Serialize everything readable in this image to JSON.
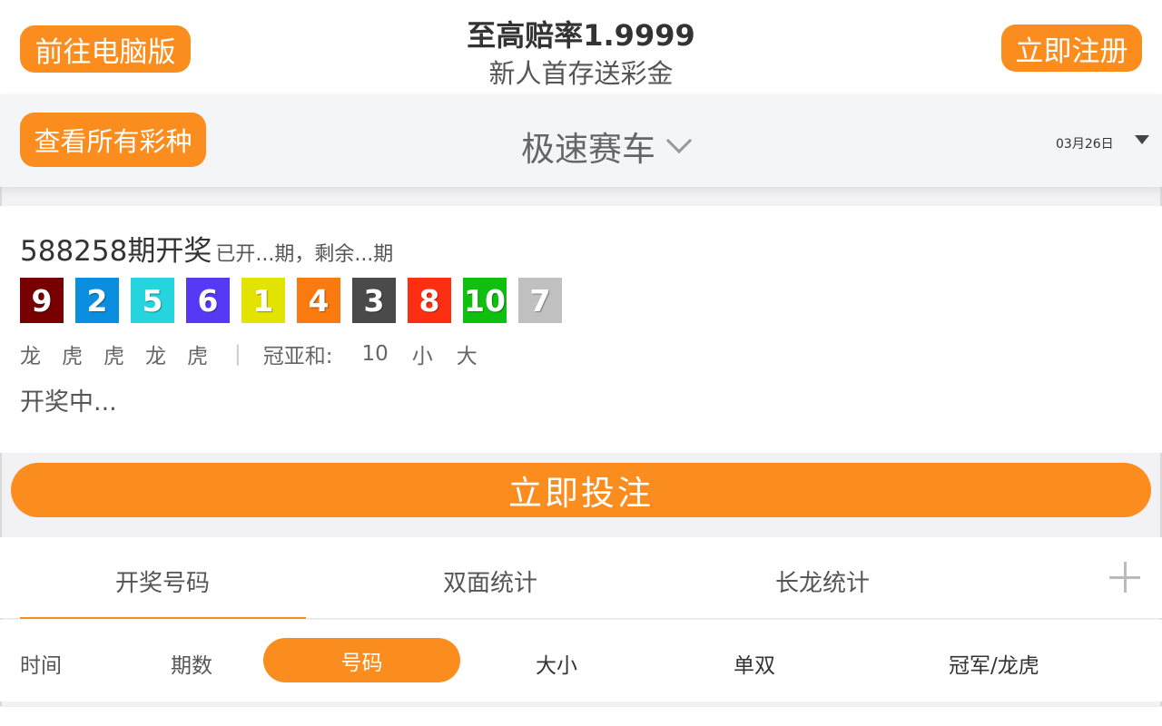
{
  "header": {
    "pc_button": "前往电脑版",
    "promo_title": "至高赔率1.9999",
    "promo_subtitle": "新人首存送彩金",
    "register_button": "立即注册"
  },
  "lottery_bar": {
    "all_lottery_button": "查看所有彩种",
    "lottery_name": "极速赛车",
    "date": "03月26日"
  },
  "result": {
    "issue": "588258期开奖",
    "progress": "已开...期，剩余...期",
    "balls": [
      {
        "number": "9",
        "color": "#770000"
      },
      {
        "number": "2",
        "color": "#0a8fe0"
      },
      {
        "number": "5",
        "color": "#25d4dc"
      },
      {
        "number": "6",
        "color": "#5539f5"
      },
      {
        "number": "1",
        "color": "#e3e300"
      },
      {
        "number": "4",
        "color": "#fb7a10"
      },
      {
        "number": "3",
        "color": "#4a4a4a"
      },
      {
        "number": "8",
        "color": "#fc2f12"
      },
      {
        "number": "10",
        "color": "#10c010"
      },
      {
        "number": "7",
        "color": "#c0c0c0"
      }
    ],
    "dragon_tiger": [
      "龙",
      "虎",
      "虎",
      "龙",
      "虎"
    ],
    "separator": "|",
    "sum_label": "冠亚和:",
    "sum_value": "10",
    "size": "小",
    "odd_even": "大",
    "status": "开奖中..."
  },
  "bet_button": "立即投注",
  "tabs": {
    "draw_numbers": "开奖号码",
    "two_sided": "双面统计",
    "long_dragon": "长龙统计"
  },
  "subtabs": {
    "time": "时间",
    "issue": "期数",
    "number": "号码",
    "size": "大小",
    "odd_even": "单双",
    "champion": "冠军/龙虎"
  },
  "colors": {
    "accent": "#fb8c1e"
  }
}
